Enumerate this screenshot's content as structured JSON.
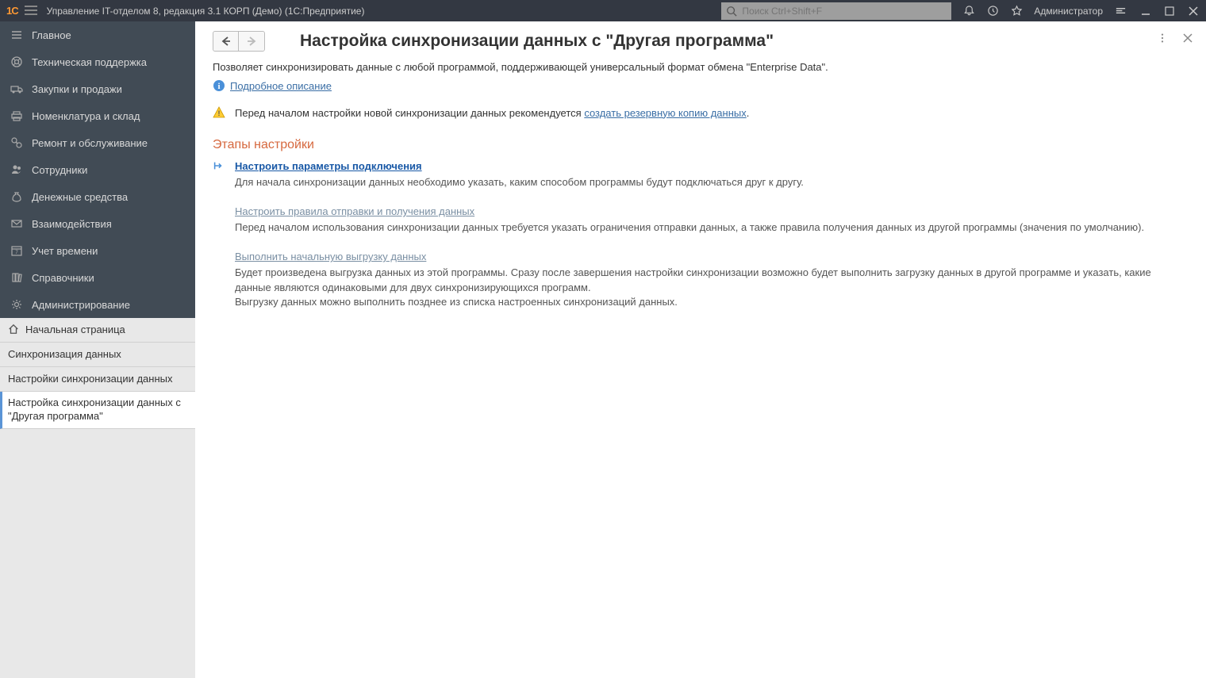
{
  "titlebar": {
    "app_title": "Управление IT-отделом 8, редакция 3.1 КОРП (Демо)  (1С:Предприятие)",
    "search_placeholder": "Поиск Ctrl+Shift+F",
    "user": "Администратор"
  },
  "sidebar": {
    "items": [
      {
        "label": "Главное"
      },
      {
        "label": "Техническая поддержка"
      },
      {
        "label": "Закупки и продажи"
      },
      {
        "label": "Номенклатура и склад"
      },
      {
        "label": "Ремонт и обслуживание"
      },
      {
        "label": "Сотрудники"
      },
      {
        "label": "Денежные средства"
      },
      {
        "label": "Взаимодействия"
      },
      {
        "label": "Учет времени"
      },
      {
        "label": "Справочники"
      },
      {
        "label": "Администрирование"
      }
    ],
    "sub": [
      {
        "label": "Начальная страница"
      },
      {
        "label": "Синхронизация данных"
      },
      {
        "label": "Настройки синхронизации данных"
      },
      {
        "label": "Настройка синхронизации данных с \"Другая программа\""
      }
    ]
  },
  "main": {
    "title": "Настройка синхронизации данных с \"Другая программа\"",
    "intro": "Позволяет синхронизировать данные с любой программой, поддерживающей универсальный формат обмена \"Enterprise Data\".",
    "details_link": "Подробное описание",
    "warning_prefix": "Перед началом настройки новой синхронизации данных рекомендуется ",
    "warning_link": "создать резервную копию данных",
    "warning_suffix": ".",
    "section_title": "Этапы настройки",
    "steps": [
      {
        "link": "Настроить параметры подключения",
        "desc": "Для начала синхронизации данных необходимо указать, каким способом программы будут подключаться друг к другу."
      },
      {
        "link": "Настроить правила отправки и получения данных",
        "desc": "Перед началом использования синхронизации данных требуется указать ограничения отправки данных, а также правила получения данных из другой программы (значения по умолчанию)."
      },
      {
        "link": "Выполнить начальную выгрузку данных",
        "desc": "Будет произведена выгрузка данных из этой программы. Сразу после завершения настройки синхронизации возможно будет выполнить загрузку данных в другой программе и указать, какие данные являются одинаковыми для двух синхронизирующихся программ.\nВыгрузку данных можно выполнить позднее из списка настроенных синхронизаций данных."
      }
    ]
  }
}
